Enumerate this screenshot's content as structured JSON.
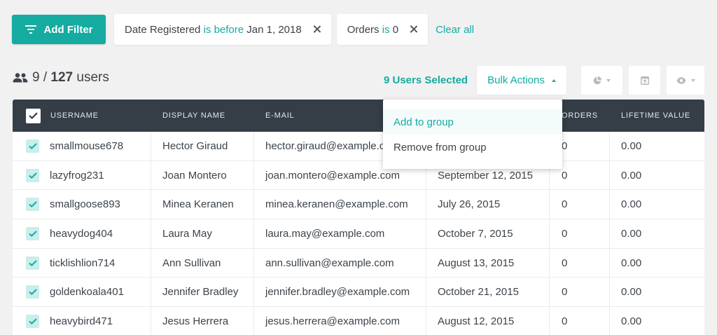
{
  "filters": {
    "add_label": "Add Filter",
    "chips": [
      {
        "field": "Date Registered",
        "operator": "is before",
        "value": "Jan 1, 2018"
      },
      {
        "field": "Orders",
        "operator": "is",
        "value": "0"
      }
    ],
    "clear_label": "Clear all"
  },
  "summary": {
    "shown": "9",
    "separator": " / ",
    "total": "127",
    "unit": "users",
    "selected": "9 Users Selected"
  },
  "bulk": {
    "label": "Bulk Actions",
    "menu": [
      "Add to group",
      "Remove from group"
    ]
  },
  "toolbar_icons": [
    "pie-chart-icon",
    "export-icon",
    "eye-icon"
  ],
  "table": {
    "headers": [
      "USERNAME",
      "DISPLAY NAME",
      "E-MAIL",
      "",
      "ORDERS",
      "LIFETIME VALUE"
    ],
    "rows": [
      {
        "username": "smallmouse678",
        "display": "Hector Giraud",
        "email": "hector.giraud@example.com",
        "date": "",
        "orders": "0",
        "ltv": "0.00"
      },
      {
        "username": "lazyfrog231",
        "display": "Joan Montero",
        "email": "joan.montero@example.com",
        "date": "September 12, 2015",
        "orders": "0",
        "ltv": "0.00"
      },
      {
        "username": "smallgoose893",
        "display": "Minea Keranen",
        "email": "minea.keranen@example.com",
        "date": "July 26, 2015",
        "orders": "0",
        "ltv": "0.00"
      },
      {
        "username": "heavydog404",
        "display": "Laura May",
        "email": "laura.may@example.com",
        "date": "October 7, 2015",
        "orders": "0",
        "ltv": "0.00"
      },
      {
        "username": "ticklishlion714",
        "display": "Ann Sullivan",
        "email": "ann.sullivan@example.com",
        "date": "August 13, 2015",
        "orders": "0",
        "ltv": "0.00"
      },
      {
        "username": "goldenkoala401",
        "display": "Jennifer Bradley",
        "email": "jennifer.bradley@example.com",
        "date": "October 21, 2015",
        "orders": "0",
        "ltv": "0.00"
      },
      {
        "username": "heavybird471",
        "display": "Jesus Herrera",
        "email": "jesus.herrera@example.com",
        "date": "August 12, 2015",
        "orders": "0",
        "ltv": "0.00"
      }
    ]
  },
  "colors": {
    "accent": "#15aba1",
    "header_bg": "#353d47",
    "page_bg": "#f1f1f1"
  }
}
